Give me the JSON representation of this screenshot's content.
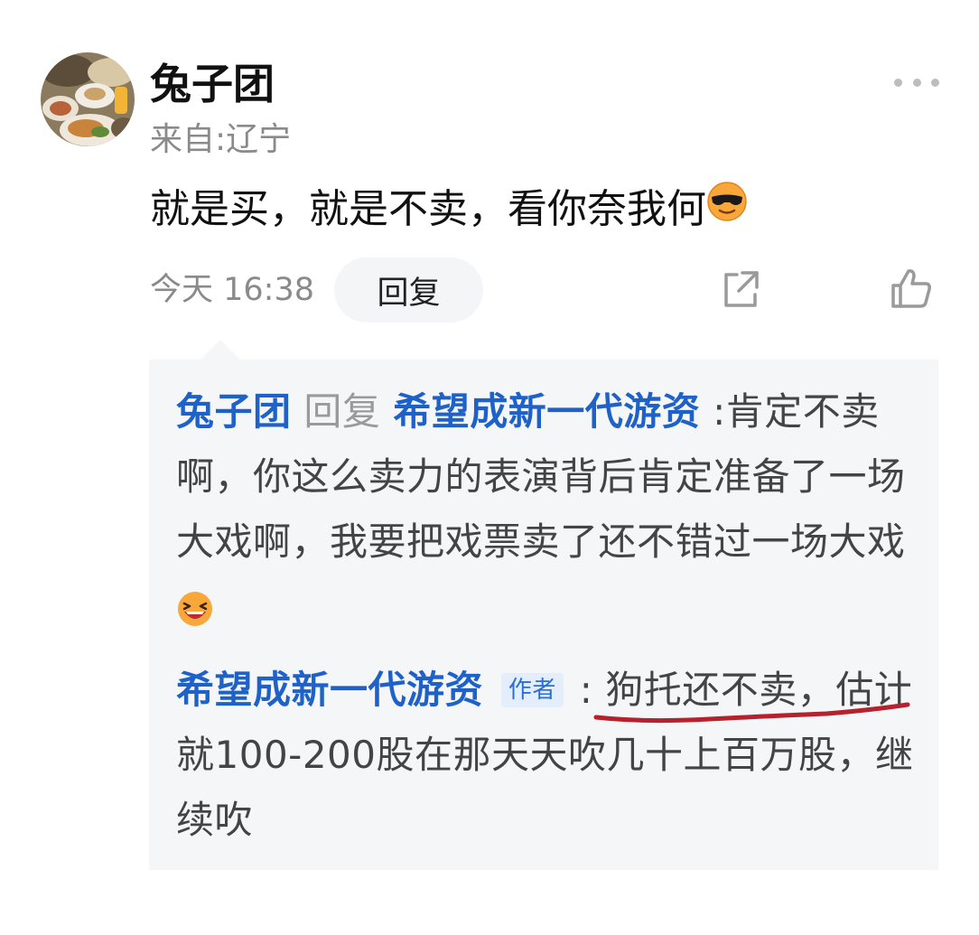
{
  "comment": {
    "username": "兔子团",
    "location": "来自:辽宁",
    "text": "就是买，就是不卖，看你奈我何",
    "time": "今天 16:38",
    "reply_label": "回复"
  },
  "replies": [
    {
      "author": "兔子团",
      "reply_word": "回复",
      "target": "希望成新一代游资",
      "separator": ":",
      "text": "肯定不卖啊，你这么卖力的表演背后肯定准备了一场大戏啊，我要把戏票卖了还不错过一场大戏"
    },
    {
      "author": "希望成新一代游资",
      "badge": "作者",
      "separator": ":",
      "text": "狗托还不卖，估计就100-200股在那天天吹几十上百万股，继续吹"
    }
  ],
  "colors": {
    "link_blue": "#1e62c9",
    "muted": "#8a8a8a",
    "box_bg": "#f5f6f8",
    "annotation_red": "#b5222e"
  },
  "icons": {
    "more": "more-dots-icon",
    "share": "share-icon",
    "like": "thumbs-up-icon",
    "emoji_1": "sunglasses-emoji-icon",
    "emoji_2": "laughing-emoji-icon"
  }
}
